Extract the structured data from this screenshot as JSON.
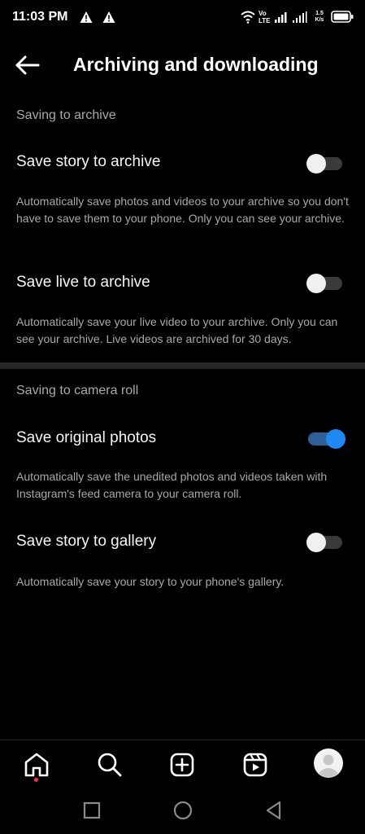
{
  "status_bar": {
    "time": "11:03 PM",
    "network_label_top": "Vo",
    "network_label_bottom": "LTE",
    "speed_value": "1.5",
    "speed_unit": "K/s"
  },
  "header": {
    "title": "Archiving and downloading",
    "back_icon": "arrow-left-icon"
  },
  "sections": {
    "archive": {
      "title": "Saving to archive",
      "save_story": {
        "label": "Save story to archive",
        "description": "Automatically save photos and videos to your archive so you don't have to save them to your phone. Only you can see your archive.",
        "enabled": false
      },
      "save_live": {
        "label": "Save live to archive",
        "description": "Automatically save your live video to your archive. Only you can see your archive. Live videos are archived for 30 days.",
        "enabled": false
      }
    },
    "camera_roll": {
      "title": "Saving to camera roll",
      "save_original": {
        "label": "Save original photos",
        "description": "Automatically save the unedited photos and videos taken with Instagram's feed camera to your camera roll.",
        "enabled": true
      },
      "save_gallery": {
        "label": "Save story to gallery",
        "description": "Automatically save your story to your phone's gallery.",
        "enabled": false
      }
    }
  },
  "bottom_nav": {
    "items": [
      "home-icon",
      "search-icon",
      "create-post-icon",
      "reels-icon",
      "profile-avatar"
    ]
  },
  "system_nav": {
    "items": [
      "recents-square-icon",
      "home-circle-icon",
      "back-triangle-icon"
    ]
  },
  "colors": {
    "background": "#000000",
    "toggle_on": "#1e88f5",
    "toggle_off_track": "#3a3a3a",
    "secondary_text": "#a8a8a8",
    "notification_dot": "#ff3040"
  }
}
